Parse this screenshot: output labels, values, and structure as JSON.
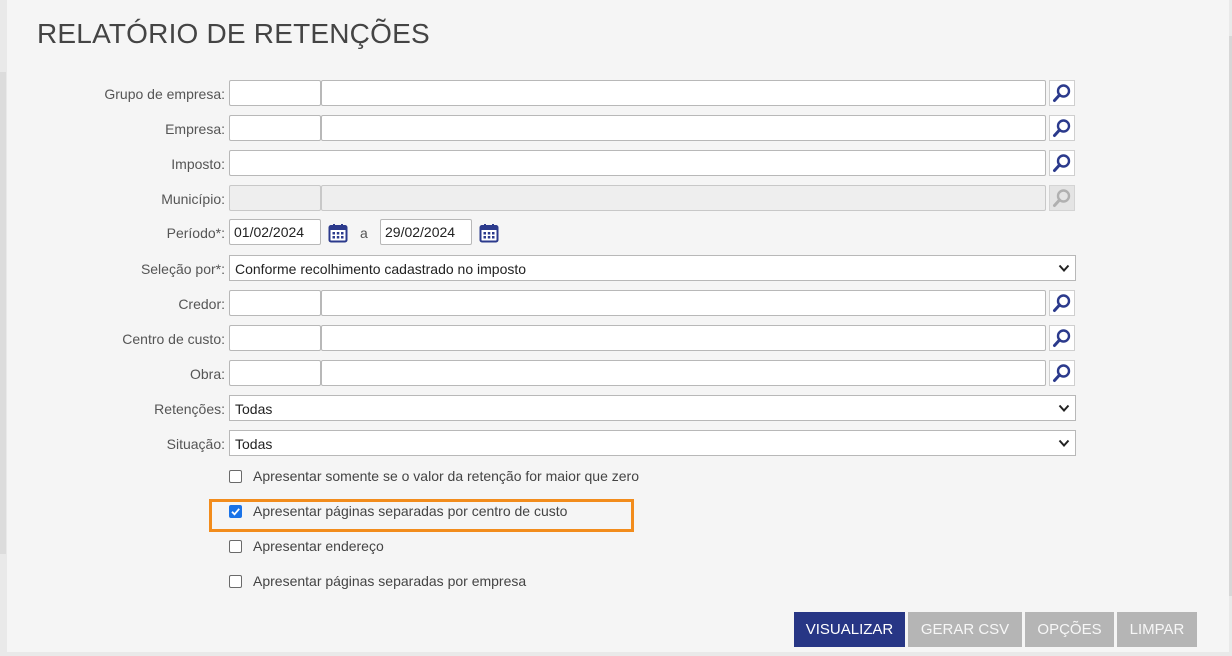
{
  "title": "RELATÓRIO DE RETENÇÕES",
  "fields": {
    "grupo_empresa": {
      "label": "Grupo de empresa:",
      "code": "",
      "desc": ""
    },
    "empresa": {
      "label": "Empresa:",
      "code": "",
      "desc": ""
    },
    "imposto": {
      "label": "Imposto:",
      "value": ""
    },
    "municipio": {
      "label": "Município:",
      "code": "",
      "desc": ""
    },
    "periodo": {
      "label": "Período*:",
      "start": "01/02/2024",
      "separator": "a",
      "end": "29/02/2024"
    },
    "selecao_por": {
      "label": "Seleção por*:",
      "value": "Conforme recolhimento cadastrado no imposto"
    },
    "credor": {
      "label": "Credor:",
      "code": "",
      "desc": ""
    },
    "centro_custo": {
      "label": "Centro de custo:",
      "code": "",
      "desc": ""
    },
    "obra": {
      "label": "Obra:",
      "code": "",
      "desc": ""
    },
    "retencoes": {
      "label": "Retenções:",
      "value": "Todas"
    },
    "situacao": {
      "label": "Situação:",
      "value": "Todas"
    }
  },
  "options": [
    {
      "label": "Apresentar somente se o valor da retenção for maior que zero",
      "checked": false
    },
    {
      "label": "Apresentar páginas separadas por centro de custo",
      "checked": true
    },
    {
      "label": "Apresentar endereço",
      "checked": false
    },
    {
      "label": "Apresentar páginas separadas por empresa",
      "checked": false
    }
  ],
  "buttons": {
    "visualizar": "VISUALIZAR",
    "gerar_csv": "GERAR CSV",
    "opcoes": "OPÇÕES",
    "limpar": "LIMPAR"
  },
  "colors": {
    "primary_button": "#273685",
    "disabled_button": "#b5b5b5",
    "highlight": "#f28c1c",
    "checkbox_checked": "#1a73e8",
    "icon": "#2b3a8c"
  },
  "icons": {
    "lookup": "search-icon",
    "calendar": "calendar-icon",
    "select": "chevron-down-icon"
  }
}
